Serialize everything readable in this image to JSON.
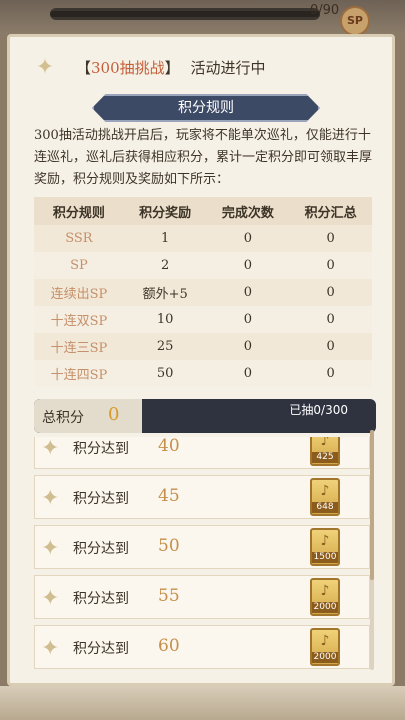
{
  "background": {
    "counter": "0/90",
    "sp_badge": "SP"
  },
  "panel": {
    "title_bracket_text": "300抽挑战",
    "title_open": "【",
    "title_close": "】",
    "title_status": "活动进行中",
    "rules_banner": "积分规则",
    "rules_text": "300抽活动挑战开启后，玩家将不能单次巡礼，仅能进行十连巡礼，巡礼后获得相应积分，累计一定积分即可领取丰厚奖励，积分规则及奖励如下所示："
  },
  "table": {
    "headers": [
      "积分规则",
      "积分奖励",
      "完成次数",
      "积分汇总"
    ],
    "rows": [
      [
        "SSR",
        "1",
        "0",
        "0"
      ],
      [
        "SP",
        "2",
        "0",
        "0"
      ],
      [
        "连续出SP",
        "额外+5",
        "0",
        "0"
      ],
      [
        "十连双SP",
        "10",
        "0",
        "0"
      ],
      [
        "十连三SP",
        "25",
        "0",
        "0"
      ],
      [
        "十连四SP",
        "50",
        "0",
        "0"
      ]
    ]
  },
  "total": {
    "label": "总积分",
    "value": "0",
    "progress_text": "已抽0/300",
    "progress_fraction": 0
  },
  "rewards": [
    {
      "label": "积分达到",
      "threshold": "40",
      "amount": "425"
    },
    {
      "label": "积分达到",
      "threshold": "45",
      "amount": "648"
    },
    {
      "label": "积分达到",
      "threshold": "50",
      "amount": "1500"
    },
    {
      "label": "积分达到",
      "threshold": "55",
      "amount": "2000"
    },
    {
      "label": "积分达到",
      "threshold": "60",
      "amount": "2000"
    }
  ],
  "icons": {
    "sparkle": "sparkle-icon",
    "reward": "gold-card-icon"
  },
  "colors": {
    "accent": "#c45f3a",
    "banner": "#3d4a66",
    "gold": "#d69b2c"
  }
}
